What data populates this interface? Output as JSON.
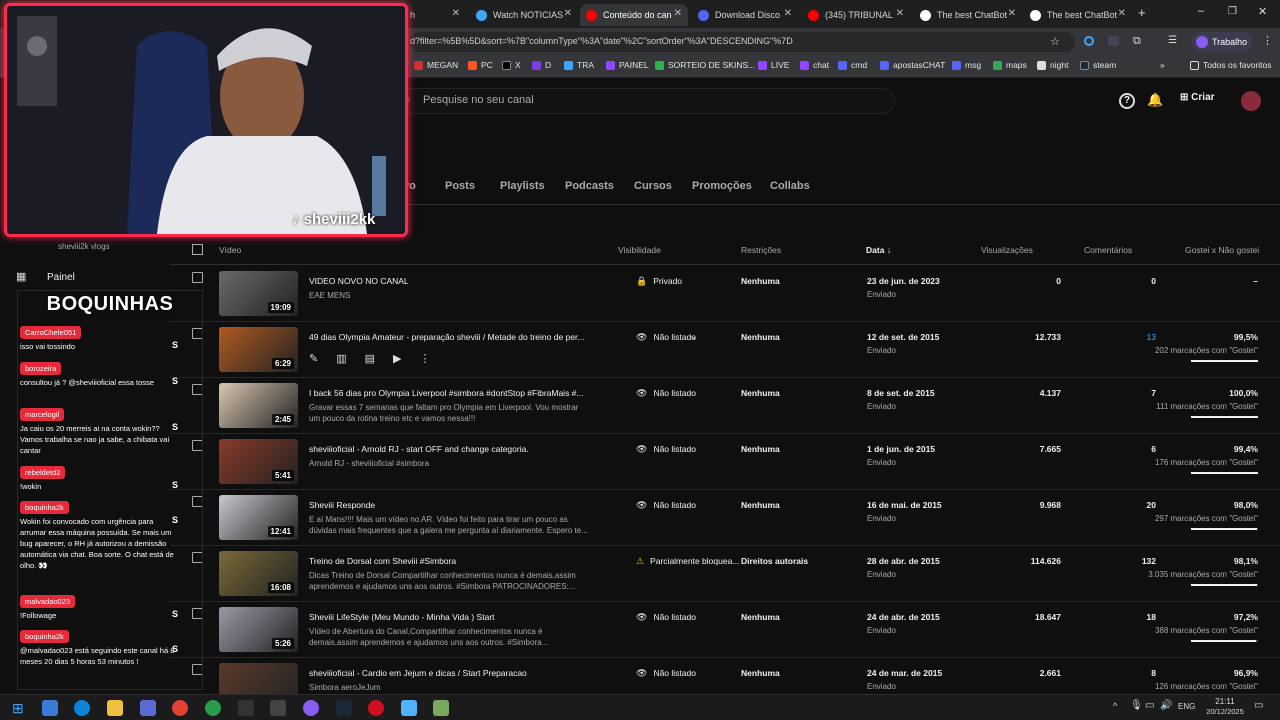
{
  "tabs": [
    {
      "label": "Watch NOTICIAS",
      "color": "#3ea6ff"
    },
    {
      "label": "Conteúdo do can",
      "color": "#ff0000"
    },
    {
      "label": "Download Disco",
      "color": "#5865f2"
    },
    {
      "label": "(345) TRIBUNAL",
      "color": "#ff0000"
    },
    {
      "label": "The best ChatBot",
      "color": "#ffffff"
    },
    {
      "label": "The best ChatBot",
      "color": "#ffffff"
    }
  ],
  "url": "d?filter=%5B%5D&sort=%7B\"columnType\"%3A\"date\"%2C\"sortOrder\"%3A\"DESCENDING\"%7D",
  "profile_label": "Trabalho",
  "bookmarks": [
    "MEGAN",
    "PC",
    "X",
    "D",
    "TRA",
    "PAINEL",
    "SORTEIO DE SKINS...",
    "LIVE",
    "chat",
    "cmd",
    "apostasCHAT",
    "msg",
    "maps",
    "night",
    "steam"
  ],
  "bookmarks_all": "Todos os favoritos",
  "search_placeholder": "Pesquise no seu canal",
  "create_label": "Criar",
  "content_tabs": [
    "vo",
    "Posts",
    "Playlists",
    "Podcasts",
    "Cursos",
    "Promoções",
    "Collabs"
  ],
  "channel_name": "sheviii2k vlogs",
  "sidebar_painel": "Painel",
  "columns": {
    "video": "Vídeo",
    "visibility": "Visibilidade",
    "restrictions": "Restrições",
    "date": "Data",
    "views": "Visualizações",
    "comments": "Comentários",
    "likes": "Gostei x Não gostei"
  },
  "videos": [
    {
      "title": "VIDEO NOVO NO CANAL",
      "desc": "EAE MENS",
      "duration": "19:09",
      "visibility": "Privado",
      "restriction": "Nenhuma",
      "date": "23 de jun. de 2023",
      "status": "Enviado",
      "views": "0",
      "comments": "0",
      "pct": "–",
      "likes": "",
      "fill": 0
    },
    {
      "title": "49 dias Olympia Amateur - preparação sheviii / Metade do treino de per...",
      "desc": "",
      "duration": "6:29",
      "visibility": "Não listado",
      "restriction": "Nenhuma",
      "date": "12 de set. de 2015",
      "status": "Enviado",
      "views": "12.733",
      "comments": "13",
      "pct": "99,5%",
      "likes": "202 marcações com \"Gostei\"",
      "fill": 0.995
    },
    {
      "title": "I back 56 dias pro Olympia Liverpool #simbora #dontStop #FibraMais #...",
      "desc": "Gravar essas 7 semanas que faltam pro Olympia em Liverpool. Vou mostrar um pouco da rotina treino etc e vamos nessa!!!",
      "duration": "2:45",
      "visibility": "Não listado",
      "restriction": "Nenhuma",
      "date": "8 de set. de 2015",
      "status": "Enviado",
      "views": "4.137",
      "comments": "7",
      "pct": "100,0%",
      "likes": "111 marcações com \"Gostei\"",
      "fill": 1.0
    },
    {
      "title": "sheviiioficial - Arnold RJ - start OFF and change categoria.",
      "desc": "Arnold RJ - sheviiioficial #simbora",
      "duration": "5:41",
      "visibility": "Não listado",
      "restriction": "Nenhuma",
      "date": "1 de jun. de 2015",
      "status": "Enviado",
      "views": "7.665",
      "comments": "6",
      "pct": "99,4%",
      "likes": "176 marcações com \"Gostei\"",
      "fill": 0.994
    },
    {
      "title": "Sheviii Responde",
      "desc": "E aí Mans!!!! Mais um vídeo no AR. Vídeo foi feito para tirar um pouco as dúvidas mais frequentes que a galera me pergunta aí diariamente. Espero te...",
      "duration": "12:41",
      "visibility": "Não listado",
      "restriction": "Nenhuma",
      "date": "16 de mai. de 2015",
      "status": "Enviado",
      "views": "9.968",
      "comments": "20",
      "pct": "98,0%",
      "likes": "297 marcações com \"Gostei\"",
      "fill": 0.98
    },
    {
      "title": "Treino de Dorsal com Sheviii #Simbora",
      "desc": "Dicas Treino de Dorsal Compartilhar conhecimentos nunca é demais,assim aprendemos e ajudamos uns aos outros. #Simbora PATROCINADORES:...",
      "duration": "16:08",
      "visibility": "Parcialmente bloquea...",
      "restriction": "Direitos autorais",
      "date": "28 de abr. de 2015",
      "status": "Enviado",
      "views": "114.626",
      "comments": "132",
      "pct": "98,1%",
      "likes": "3.035 marcações com \"Gostei\"",
      "fill": 0.981
    },
    {
      "title": "Sheviii LifeStyle (Meu Mundo - Minha Vida ) Start",
      "desc": "Vídeo de Abertura do Canal,Compartilhar conhecimentos nunca é demais,assim aprendemos e ajudamos uns aos outros. #Simbora...",
      "duration": "5:26",
      "visibility": "Não listado",
      "restriction": "Nenhuma",
      "date": "24 de abr. de 2015",
      "status": "Enviado",
      "views": "18.647",
      "comments": "18",
      "pct": "97,2%",
      "likes": "388 marcações com \"Gostei\"",
      "fill": 0.972
    },
    {
      "title": "sheviiioficial - Cardio em Jejum e dicas / Start Preparacao",
      "desc": "Simbora aeroJeJum",
      "duration": "",
      "visibility": "Não listado",
      "restriction": "Nenhuma",
      "date": "24 de mar. de 2015",
      "status": "Enviado",
      "views": "2.661",
      "comments": "8",
      "pct": "96,9%",
      "likes": "126 marcações com \"Gostei\"",
      "fill": 0.969
    }
  ],
  "webcam_handle": "sheviii2kk",
  "chat_title": "BOQUINHAS",
  "chat": [
    {
      "user": "CarroChefe051",
      "msg": "isso vai tossindo"
    },
    {
      "user": "borozeira",
      "msg": "consultou já ? @sheviiioficial essa tosse"
    },
    {
      "user": "marcelogil",
      "msg": "Ja caiu os 20 merreis ai na conta wokin?? Vamos trabalha se nao ja sabe, a chibata vai cantar"
    },
    {
      "user": "rebeldetd2",
      "msg": "!wokin"
    },
    {
      "user": "boquinha2k",
      "msg": "Wokin foi convocado com urgência para arrumar essa máquina possuída. Se mais um bug aparecer, o RH já autorizou a demissão automática via chat. Boa sorte. O chat está de olho. 👀"
    },
    {
      "user": "malvadao023",
      "msg": "!Followage"
    },
    {
      "user": "boquinha2k",
      "msg": "@malvadao023 está seguindo este canal há 8 meses 20 dias 5 horas 53 minutos !"
    }
  ],
  "clock": {
    "time": "21:11",
    "date": "20/12/2025",
    "lang": "ENG"
  }
}
